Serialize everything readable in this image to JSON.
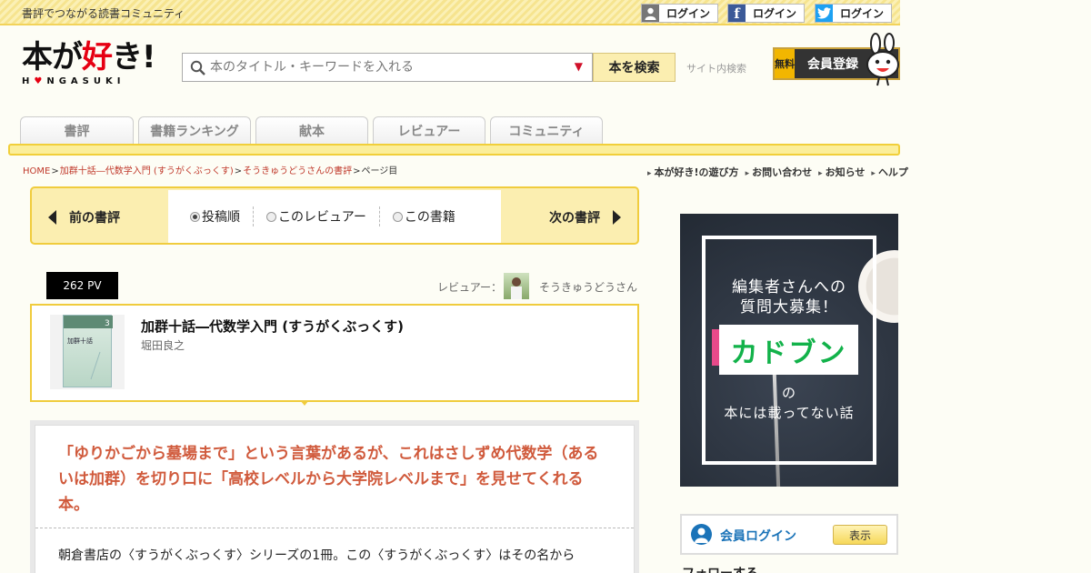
{
  "header": {
    "tagline": "書評でつながる読書コミュニティ",
    "logins": [
      {
        "label": "ログイン",
        "icon": "user-icon"
      },
      {
        "label": "ログイン",
        "icon": "facebook-icon"
      },
      {
        "label": "ログイン",
        "icon": "twitter-icon"
      }
    ],
    "logo": {
      "line1a": "本が",
      "line1b": "好",
      "line1c": "き!",
      "line2a": "H",
      "line2b": "♥",
      "line2c": "NGASUKI"
    },
    "search": {
      "placeholder": "本のタイトル・キーワードを入れる",
      "button": "本を検索",
      "site_label": "サイト内検索"
    },
    "register": {
      "free": "無料",
      "label": "会員登録"
    }
  },
  "nav": {
    "tabs": [
      "書評",
      "書籍ランキング",
      "献本",
      "レビュアー",
      "コミュニティ"
    ]
  },
  "breadcrumb": {
    "items": [
      "HOME",
      "加群十話―代数学入門 (すうがくぶっくす)",
      "そうきゅうどうさんの書評"
    ],
    "current": "ページ目",
    "sep": ">"
  },
  "util_links": [
    "本が好き!の遊び方",
    "お問い合わせ",
    "お知らせ",
    "ヘルプ"
  ],
  "pager": {
    "prev": "前の書評",
    "next": "次の書評",
    "options": [
      "投稿順",
      "このレビュアー",
      "この書籍"
    ],
    "selected": 0
  },
  "review_meta": {
    "pv": "262 PV",
    "reviewer_label": "レビュアー：",
    "reviewer_name": "そうきゅうどうさん"
  },
  "book": {
    "title": "加群十話―代数学入門 (すうがくぶっくす)",
    "author": "堀田良之",
    "cover_text": "加群十話",
    "cover_num": "3"
  },
  "review": {
    "headline": "「ゆりかごから墓場まで」という言葉があるが、これはさしずめ代数学（あるいは加群）を切り口に「高校レベルから大学院レベルまで」を見せてくれる本。",
    "body": "朝倉書店の〈すうがくぶっくす〉シリーズの1冊。この〈すうがくぶっくす〉はその名から"
  },
  "ad": {
    "line1": "編集者さんへの",
    "line2": "質問大募集！",
    "logo": "カドブン",
    "line3": "の",
    "line4": "本には載ってない話"
  },
  "member": {
    "label": "会員ログイン",
    "button": "表示"
  },
  "follow": "フォローする",
  "colors": {
    "accent_yellow": "#f0cc3d",
    "link_red": "#c0392b",
    "headline": "#d05a3c",
    "member_blue": "#1a73b8"
  }
}
